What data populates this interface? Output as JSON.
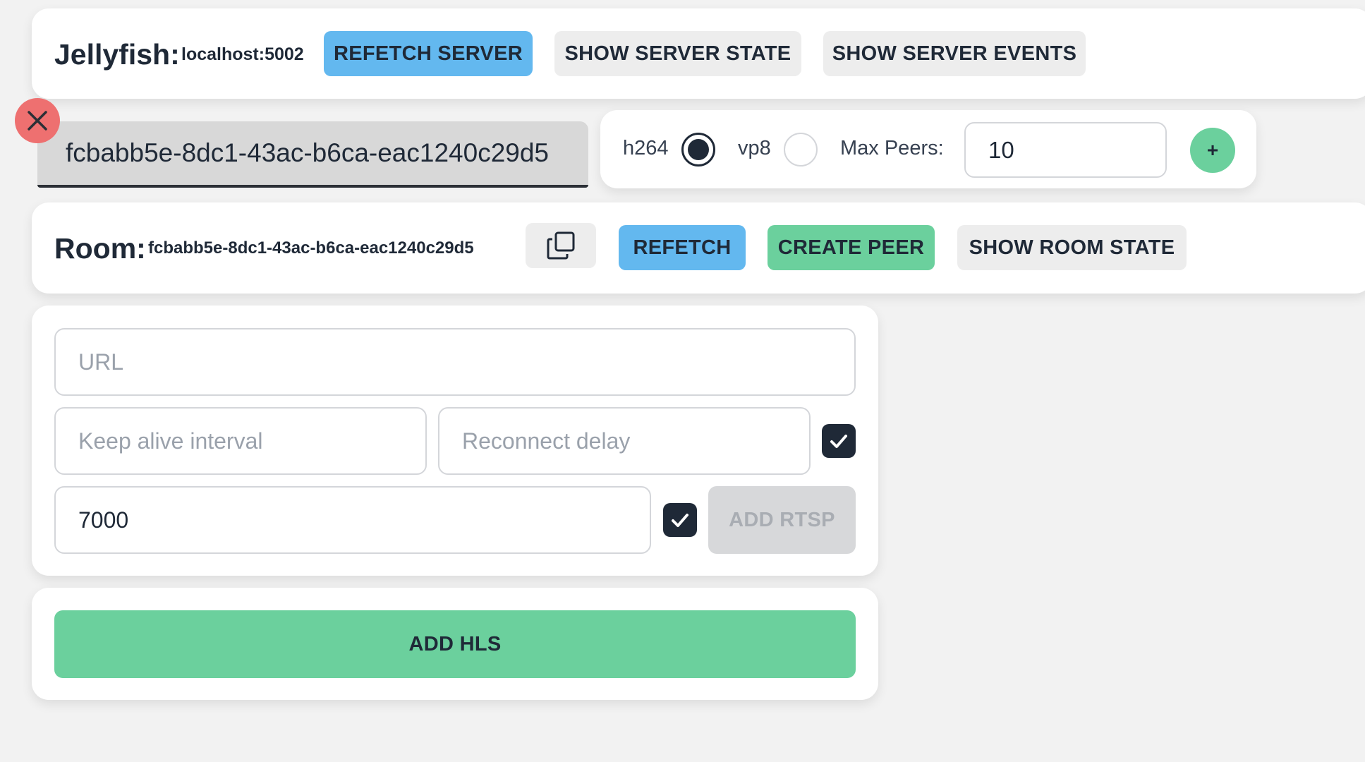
{
  "server_bar": {
    "title": "Jellyfish:",
    "host": "localhost:5002",
    "refetch_label": "REFETCH SERVER",
    "show_state_label": "SHOW SERVER STATE",
    "show_events_label": "SHOW SERVER EVENTS"
  },
  "room_tab": {
    "room_id": "fcbabb5e-8dc1-43ac-b6ca-eac1240c29d5"
  },
  "room_options": {
    "codecs": [
      {
        "label": "h264",
        "checked": true
      },
      {
        "label": "vp8",
        "checked": false
      }
    ],
    "max_peers_label": "Max Peers:",
    "max_peers_value": "10",
    "add_label": "+"
  },
  "room_bar": {
    "title": "Room:",
    "room_id": "fcbabb5e-8dc1-43ac-b6ca-eac1240c29d5",
    "refetch_label": "REFETCH",
    "create_peer_label": "CREATE PEER",
    "show_state_label": "SHOW ROOM STATE"
  },
  "rtsp_form": {
    "url_placeholder": "URL",
    "url_value": "",
    "keep_alive_placeholder": "Keep alive interval",
    "reconnect_placeholder": "Reconnect delay",
    "port_value": "7000",
    "add_rtsp_label": "ADD RTSP"
  },
  "hls": {
    "add_hls_label": "ADD HLS"
  },
  "colors": {
    "blue": "#63b8ef",
    "green": "#6bd09d",
    "red": "#ee7070",
    "dark": "#1f2937"
  }
}
